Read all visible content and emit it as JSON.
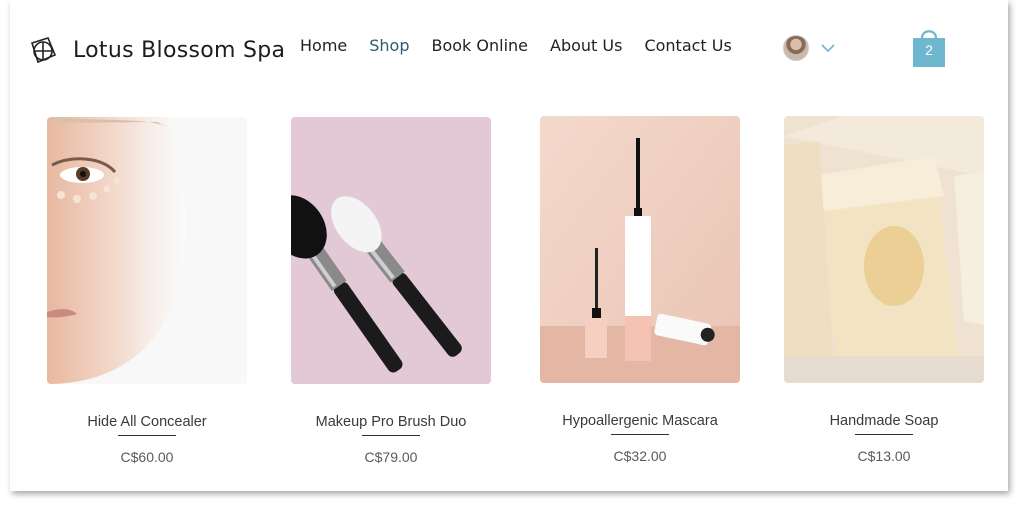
{
  "header": {
    "brand": "Lotus Blossom Spa",
    "nav": [
      {
        "label": "Home",
        "active": false
      },
      {
        "label": "Shop",
        "active": true
      },
      {
        "label": "Book Online",
        "active": false
      },
      {
        "label": "About Us",
        "active": false
      },
      {
        "label": "Contact Us",
        "active": false
      }
    ],
    "cart_count": "2",
    "accent_color": "#6fb7cf"
  },
  "products": [
    {
      "name": "Hide All Concealer",
      "price": "C$60.00"
    },
    {
      "name": "Makeup Pro Brush Duo",
      "price": "C$79.00"
    },
    {
      "name": "Hypoallergenic Mascara",
      "price": "C$32.00"
    },
    {
      "name": "Handmade Soap",
      "price": "C$13.00"
    }
  ]
}
